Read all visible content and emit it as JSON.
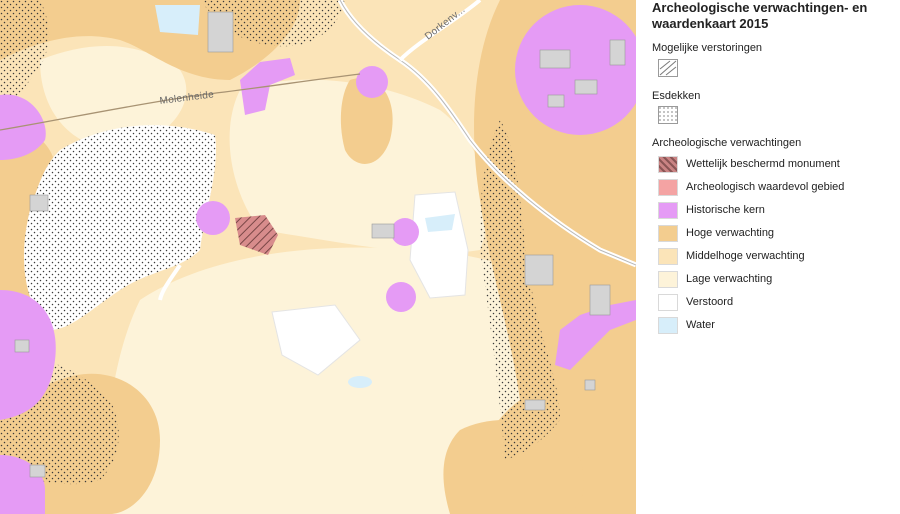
{
  "map": {
    "road_labels": [
      "Molenheide",
      "Dorkenv..."
    ]
  },
  "legend": {
    "title": "Archeologische verwachtingen- en waardenkaart 2015",
    "sections": {
      "disturbances": "Mogelijke verstoringen",
      "esdekken": "Esdekken",
      "expectations": "Archeologische verwachtingen"
    },
    "items": [
      {
        "label": "Wettelijk beschermd monument",
        "color": "#c98383",
        "pattern": "hatch"
      },
      {
        "label": "Archeologisch waardevol gebied",
        "color": "#f4a3a3"
      },
      {
        "label": "Historische kern",
        "color": "#e59bf5"
      },
      {
        "label": "Hoge verwachting",
        "color": "#f3cd8f"
      },
      {
        "label": "Middelhoge verwachting",
        "color": "#fbe4b8"
      },
      {
        "label": "Lage verwachting",
        "color": "#fdf3d9"
      },
      {
        "label": "Verstoord",
        "color": "#ffffff"
      },
      {
        "label": "Water",
        "color": "#d7eefa"
      }
    ]
  }
}
